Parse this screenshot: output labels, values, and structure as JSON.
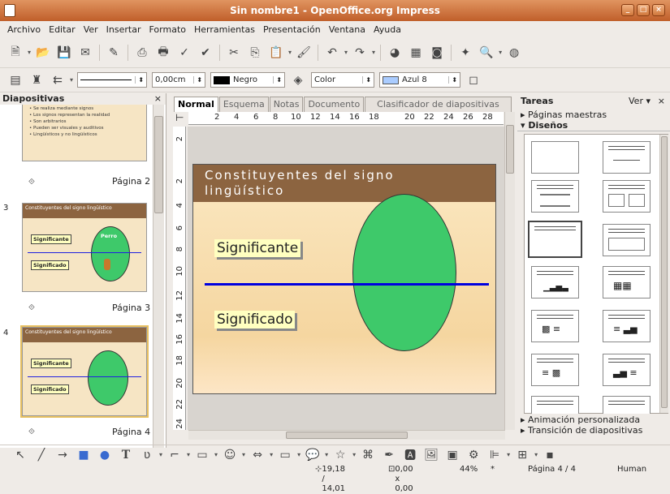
{
  "window": {
    "title": "Sin nombre1 - OpenOffice.org Impress"
  },
  "menu": [
    "Archivo",
    "Editar",
    "Ver",
    "Insertar",
    "Formato",
    "Herramientas",
    "Presentación",
    "Ventana",
    "Ayuda"
  ],
  "format_bar": {
    "line_width": "0,00cm",
    "line_color": "Negro",
    "area_style": "Color",
    "area_color": "Azul 8"
  },
  "slides_panel": {
    "title": "Diapositivas",
    "slide1_bullets": [
      "• Se realiza mediante signos",
      "• Los signos representan la realidad",
      "• Son arbitrarios",
      "• Pueden ser visuales y auditivos",
      "• Lingüísticos y no lingüísticos"
    ],
    "slide_title": "Constituyentes del signo lingüístico",
    "label_significante": "Significante",
    "label_significado": "Significado",
    "label_perro": "Perro",
    "pages": [
      {
        "num": "",
        "label": "Página 2"
      },
      {
        "num": "3",
        "label": "Página 3"
      },
      {
        "num": "4",
        "label": "Página 4"
      }
    ]
  },
  "view_tabs": [
    "Normal",
    "Esquema",
    "Notas",
    "Documento",
    "Clasificador de diapositivas"
  ],
  "ruler": {
    "h": [
      "2",
      "4",
      "6",
      "8",
      "10",
      "12",
      "14",
      "16",
      "18",
      "20",
      "22",
      "24",
      "26",
      "28"
    ],
    "v": [
      "2",
      "2",
      "4",
      "6",
      "8",
      "10",
      "12",
      "14",
      "16",
      "18",
      "20",
      "22",
      "24"
    ]
  },
  "slide": {
    "title_line1": "Constituyentes del signo",
    "title_line2": "lingüístico",
    "significante": "Significante",
    "significado": "Significado"
  },
  "tasks": {
    "title": "Tareas",
    "view": "Ver",
    "master": "Páginas maestras",
    "layouts": "Diseños",
    "custom_anim": "Animación personalizada",
    "transition": "Transición de diapositivas"
  },
  "status": {
    "position": "19,18 / 14,01",
    "size": "0,00 x 0,00",
    "zoom": "44%",
    "modified": "*",
    "page": "Página 4 / 4",
    "style": "Human"
  },
  "colors": {
    "title_bar": "#c96a35",
    "slide_header": "#8c6440",
    "ellipse": "#3ec96a",
    "line": "#0000e0",
    "label_bg": "#ffffc0"
  }
}
